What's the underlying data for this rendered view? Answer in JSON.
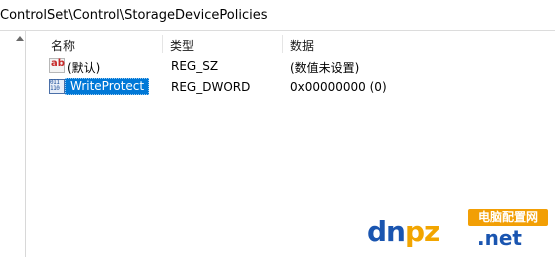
{
  "address": {
    "path": "ControlSet\\Control\\StorageDevicePolicies"
  },
  "columns": {
    "name": "名称",
    "type": "类型",
    "data": "数据"
  },
  "rows": [
    {
      "icon": "string-value-icon",
      "name": "(默认)",
      "type": "REG_SZ",
      "data": "(数值未设置)"
    },
    {
      "icon": "binary-value-icon",
      "name": "WriteProtect",
      "type": "REG_DWORD",
      "data": "0x00000000 (0)",
      "selected": true
    }
  ],
  "icons": {
    "string_glyph": "ab",
    "binary_glyph": "011\n110"
  },
  "watermark": {
    "main_a": "dn",
    "main_z": "pz",
    "net": ".net",
    "badge": "电脑配置网"
  },
  "colors": {
    "selection": "#0078d7",
    "watermark_blue": "#1a55b0",
    "watermark_orange": "#f29f05"
  }
}
